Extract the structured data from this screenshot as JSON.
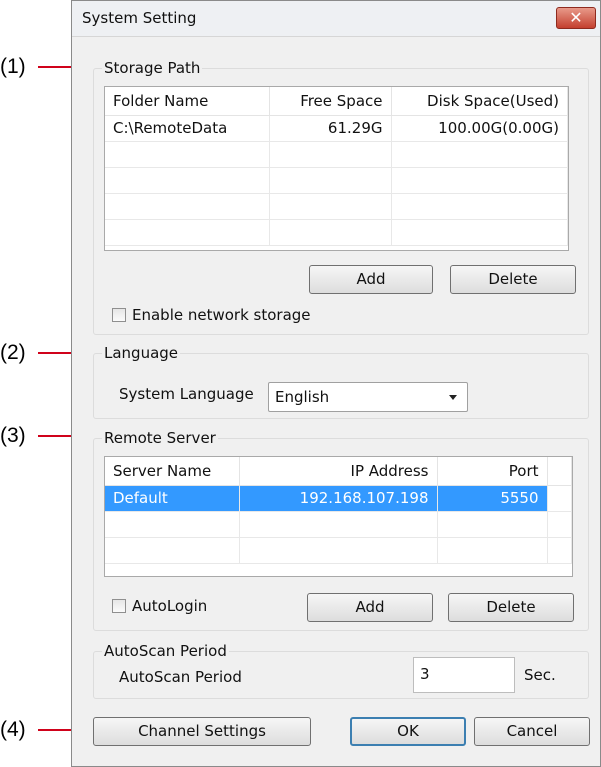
{
  "callouts": [
    "(1)",
    "(2)",
    "(3)",
    "(4)"
  ],
  "window": {
    "title": "System Setting",
    "close_glyph": "✕"
  },
  "storage": {
    "group_title": "Storage Path",
    "columns": [
      "Folder Name",
      "Free Space",
      "Disk Space(Used)"
    ],
    "rows": [
      [
        "C:\\RemoteData",
        "61.29G",
        "100.00G(0.00G)"
      ]
    ],
    "add_label": "Add",
    "delete_label": "Delete",
    "network_checkbox_label": "Enable network storage",
    "network_checked": false
  },
  "language": {
    "group_title": "Language",
    "label": "System Language",
    "selected": "English"
  },
  "remote": {
    "group_title": "Remote Server",
    "columns": [
      "Server Name",
      "IP Address",
      "Port"
    ],
    "rows": [
      [
        "Default",
        "192.168.107.198",
        "5550"
      ]
    ],
    "autologin_label": "AutoLogin",
    "autologin_checked": false,
    "add_label": "Add",
    "delete_label": "Delete"
  },
  "autoscan": {
    "group_title": "AutoScan Period",
    "label": "AutoScan Period",
    "value": "3",
    "unit": "Sec."
  },
  "footer": {
    "channel_settings_label": "Channel Settings",
    "ok_label": "OK",
    "cancel_label": "Cancel"
  },
  "colors": {
    "selection": "#3399ff",
    "callout_line": "#d0021b",
    "close_button": "#c4402f"
  }
}
